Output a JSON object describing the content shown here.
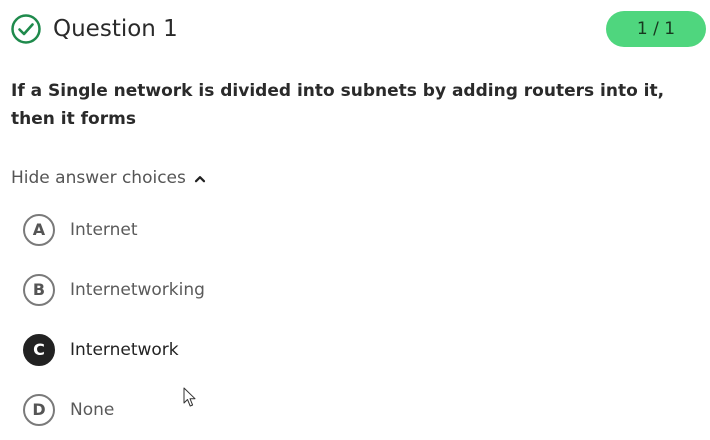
{
  "header": {
    "title": "Question 1",
    "score": "1 / 1",
    "status_icon": "check-circle-icon",
    "score_badge_color": "#4fd67e",
    "status_icon_color": "#1f8a4c"
  },
  "question": {
    "text": "If a Single network is divided into subnets by adding routers into it, then it forms"
  },
  "answer_toggle": {
    "label": "Hide answer choices",
    "icon": "chevron-up-icon"
  },
  "choices": [
    {
      "letter": "A",
      "text": "Internet",
      "selected": false
    },
    {
      "letter": "B",
      "text": "Internetworking",
      "selected": false
    },
    {
      "letter": "C",
      "text": "Internetwork",
      "selected": true
    },
    {
      "letter": "D",
      "text": "None",
      "selected": false
    }
  ],
  "cursor": {
    "icon": "mouse-pointer-icon"
  }
}
